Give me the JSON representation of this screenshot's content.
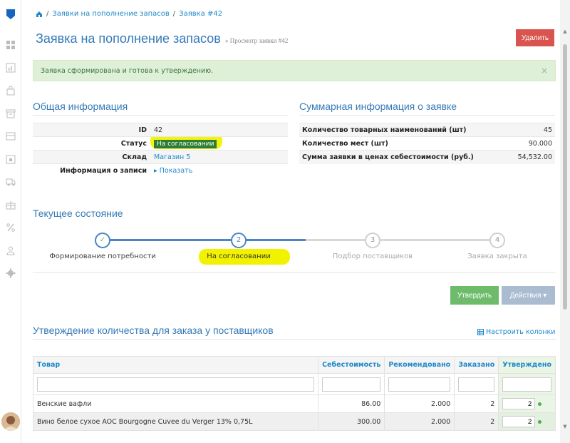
{
  "breadcrumb": {
    "home_icon": "home-icon",
    "items": [
      "Заявки на пополнение запасов",
      "Заявка #42"
    ],
    "separator": "/"
  },
  "header": {
    "title": "Заявка на пополнение запасов",
    "subtitle": "» Просмотр заявки #42",
    "delete_label": "Удалить"
  },
  "alert": {
    "text": "Заявка сформирована и готова к утверждению.",
    "close": "×"
  },
  "general": {
    "title": "Общая информация",
    "rows": [
      {
        "key": "ID",
        "value": "42"
      },
      {
        "key": "Статус",
        "value": "На согласовании"
      },
      {
        "key": "Склад",
        "value": "Магазин 5"
      },
      {
        "key": "Информация о записи",
        "value": "▸ Показать"
      }
    ]
  },
  "summary": {
    "title": "Суммарная информация о заявке",
    "rows": [
      {
        "key": "Количество товарных наименований (шт)",
        "value": "45"
      },
      {
        "key": "Количество мест (шт)",
        "value": "90.000"
      },
      {
        "key": "Сумма заявки в ценах себестоимости (руб.)",
        "value": "54,532.00"
      }
    ]
  },
  "state": {
    "title": "Текущее состояние",
    "steps": [
      {
        "num": "✓",
        "label": "Формирование потребности",
        "status": "done"
      },
      {
        "num": "2",
        "label": "На согласовании",
        "status": "current"
      },
      {
        "num": "3",
        "label": "Подбор поставщиков",
        "status": "pending"
      },
      {
        "num": "4",
        "label": "Заявка закрыта",
        "status": "pending"
      }
    ]
  },
  "actions": {
    "approve_label": "Утвердить",
    "actions_label": "Действия ▾"
  },
  "approval": {
    "title": "Утверждение количества для заказа у поставщиков",
    "configure_label": "Настроить колонки",
    "columns": [
      "Товар",
      "Себестоимость",
      "Рекомендовано",
      "Заказано",
      "Утверждено"
    ],
    "rows": [
      {
        "product": "Венские вафли",
        "cost": "86.00",
        "recommended": "2.000",
        "ordered": "2",
        "approved": "2"
      },
      {
        "product": "Вино белое сухое AOC Bourgogne Cuvee du Verger 13% 0,75L",
        "cost": "300.00",
        "recommended": "2.000",
        "ordered": "2",
        "approved": "2"
      }
    ]
  },
  "colors": {
    "accent": "#337ab7",
    "link": "#1e88c9",
    "success": "#6dbb6b",
    "danger": "#d9534f",
    "highlight": "#f2f200"
  }
}
